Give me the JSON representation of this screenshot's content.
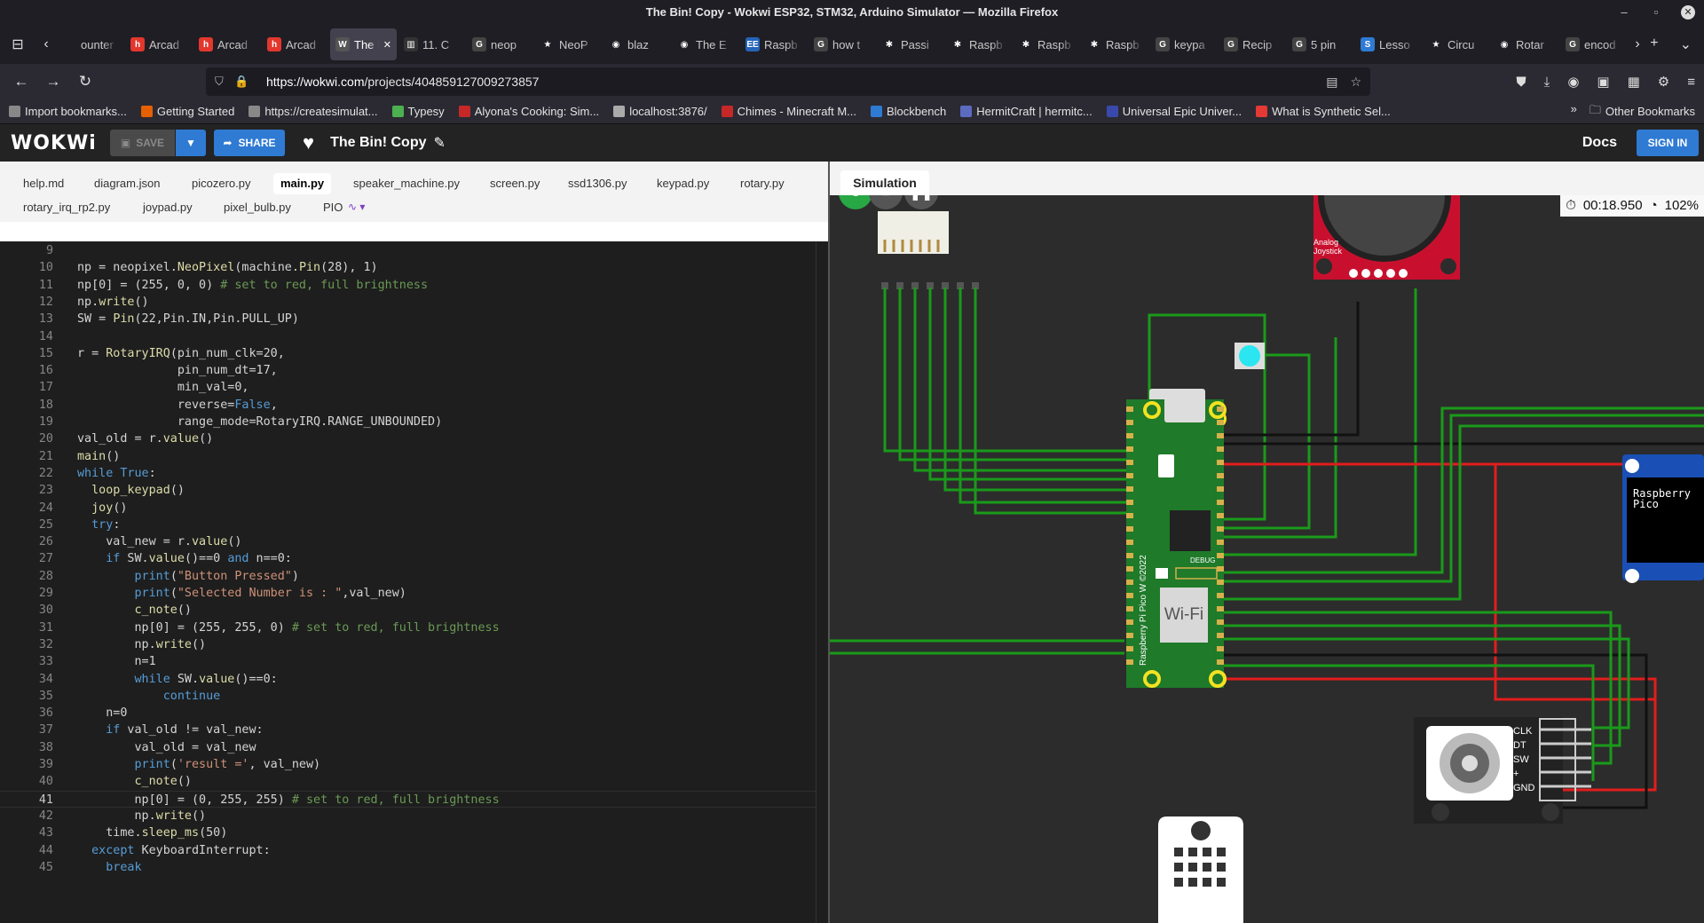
{
  "window": {
    "title": "The Bin! Copy - Wokwi ESP32, STM32, Arduino Simulator — Mozilla Firefox"
  },
  "tabs": [
    {
      "label": "ounter",
      "fav": "",
      "color": "#1f1e25"
    },
    {
      "label": "Arcad",
      "fav": "h",
      "color": "#e3372d"
    },
    {
      "label": "Arcad",
      "fav": "h",
      "color": "#e3372d"
    },
    {
      "label": "Arcad",
      "fav": "h",
      "color": "#e3372d"
    },
    {
      "label": "The PLA",
      "fav": "W",
      "color": "#555555",
      "active": true
    },
    {
      "label": "11. C",
      "fav": "▥",
      "color": "#333333"
    },
    {
      "label": "neop",
      "fav": "G",
      "color": "#444444"
    },
    {
      "label": "NeoP",
      "fav": "★",
      "color": "#1f1e25"
    },
    {
      "label": "blaz",
      "fav": "◉",
      "color": "#1f1e25"
    },
    {
      "label": "The E",
      "fav": "◉",
      "color": "#1f1e25"
    },
    {
      "label": "Raspb",
      "fav": "EE",
      "color": "#2563b8"
    },
    {
      "label": "how t",
      "fav": "G",
      "color": "#444444"
    },
    {
      "label": "Passi",
      "fav": "✱",
      "color": "#1f1e25"
    },
    {
      "label": "Raspb",
      "fav": "✱",
      "color": "#1f1e25"
    },
    {
      "label": "Raspb",
      "fav": "✱",
      "color": "#1f1e25"
    },
    {
      "label": "Raspb",
      "fav": "✱",
      "color": "#1f1e25"
    },
    {
      "label": "keypa",
      "fav": "G",
      "color": "#444444"
    },
    {
      "label": "Recip",
      "fav": "G",
      "color": "#444444"
    },
    {
      "label": "5 pin",
      "fav": "G",
      "color": "#444444"
    },
    {
      "label": "Lesso",
      "fav": "S",
      "color": "#2f7ad3"
    },
    {
      "label": "Circu",
      "fav": "★",
      "color": "#1f1e25"
    },
    {
      "label": "Rotar",
      "fav": "◉",
      "color": "#1f1e25"
    },
    {
      "label": "encod",
      "fav": "G",
      "color": "#444444"
    }
  ],
  "nav": {
    "url_host": "https://wokwi.com",
    "url_path": "/projects/404859127009273857"
  },
  "bookmarks": [
    {
      "label": "Import bookmarks...",
      "color": "#888888"
    },
    {
      "label": "Getting Started",
      "color": "#e66000"
    },
    {
      "label": "https://createsimulat...",
      "color": "#888888"
    },
    {
      "label": "Typesy",
      "color": "#4caf50"
    },
    {
      "label": "Alyona's Cooking: Sim...",
      "color": "#c62828"
    },
    {
      "label": "localhost:3876/",
      "color": "#aaaaaa"
    },
    {
      "label": "Chimes - Minecraft M...",
      "color": "#c62828"
    },
    {
      "label": "Blockbench",
      "color": "#2f7ad3"
    },
    {
      "label": "HermitCraft | hermitc...",
      "color": "#5c6bc0"
    },
    {
      "label": "Universal Epic Univer...",
      "color": "#3949ab"
    },
    {
      "label": "What is Synthetic Sel...",
      "color": "#e53935"
    }
  ],
  "other_bookmarks": "Other Bookmarks",
  "wokwi": {
    "logo": "WOKWi",
    "save": "SAVE",
    "share": "SHARE",
    "project": "The Bin! Copy",
    "docs": "Docs",
    "signin": "SIGN IN"
  },
  "files": [
    "help.md",
    "diagram.json",
    "picozero.py",
    "main.py",
    "speaker_machine.py",
    "screen.py",
    "ssd1306.py",
    "keypad.py",
    "rotary.py",
    "rotary_irq_rp2.py",
    "joypad.py",
    "pixel_bulb.py",
    "PIO"
  ],
  "active_file": "main.py",
  "code": [
    {
      "n": "9",
      "t": ""
    },
    {
      "n": "10",
      "t": "np = neopixel.NeoPixel(machine.Pin(28), 1)"
    },
    {
      "n": "11",
      "t": "np[0] = (255, 0, 0) # set to red, full brightness"
    },
    {
      "n": "12",
      "t": "np.write()"
    },
    {
      "n": "13",
      "t": "SW = Pin(22,Pin.IN,Pin.PULL_UP)"
    },
    {
      "n": "14",
      "t": ""
    },
    {
      "n": "15",
      "t": "r = RotaryIRQ(pin_num_clk=20,"
    },
    {
      "n": "16",
      "t": "              pin_num_dt=17,"
    },
    {
      "n": "17",
      "t": "              min_val=0,"
    },
    {
      "n": "18",
      "t": "              reverse=False,"
    },
    {
      "n": "19",
      "t": "              range_mode=RotaryIRQ.RANGE_UNBOUNDED)"
    },
    {
      "n": "20",
      "t": "val_old = r.value()"
    },
    {
      "n": "21",
      "t": "main()"
    },
    {
      "n": "22",
      "t": "while True:"
    },
    {
      "n": "23",
      "t": "  loop_keypad()"
    },
    {
      "n": "24",
      "t": "  joy()"
    },
    {
      "n": "25",
      "t": "  try:"
    },
    {
      "n": "26",
      "t": "    val_new = r.value()"
    },
    {
      "n": "27",
      "t": "    if SW.value()==0 and n==0:"
    },
    {
      "n": "28",
      "t": "        print(\"Button Pressed\")"
    },
    {
      "n": "29",
      "t": "        print(\"Selected Number is : \",val_new)"
    },
    {
      "n": "30",
      "t": "        c_note()"
    },
    {
      "n": "31",
      "t": "        np[0] = (255, 255, 0) # set to red, full brightness"
    },
    {
      "n": "32",
      "t": "        np.write()"
    },
    {
      "n": "33",
      "t": "        n=1"
    },
    {
      "n": "34",
      "t": "        while SW.value()==0:"
    },
    {
      "n": "35",
      "t": "            continue"
    },
    {
      "n": "36",
      "t": "    n=0"
    },
    {
      "n": "37",
      "t": "    if val_old != val_new:"
    },
    {
      "n": "38",
      "t": "        val_old = val_new"
    },
    {
      "n": "39",
      "t": "        print('result =', val_new)"
    },
    {
      "n": "40",
      "t": "        c_note()"
    },
    {
      "n": "41",
      "t": "        np[0] = (0, 255, 255) # set to red, full brightness"
    },
    {
      "n": "42",
      "t": "        np.write()"
    },
    {
      "n": "43",
      "t": "    time.sleep_ms(50)"
    },
    {
      "n": "44",
      "t": "  except KeyboardInterrupt:"
    },
    {
      "n": "45",
      "t": "    break"
    }
  ],
  "current_line": "41",
  "simulation": {
    "tab": "Simulation",
    "timer": "00:18.950",
    "speed": "102%",
    "pico_label": "Raspberry Pi Pico W ©2022",
    "wifi": "Wi-Fi",
    "debug": "DEBUG",
    "joystick_label": "Analog Joystick",
    "oled_text": "Raspberry Pico",
    "encoder_pins": [
      "CLK",
      "DT",
      "SW",
      "+",
      "GND"
    ]
  }
}
